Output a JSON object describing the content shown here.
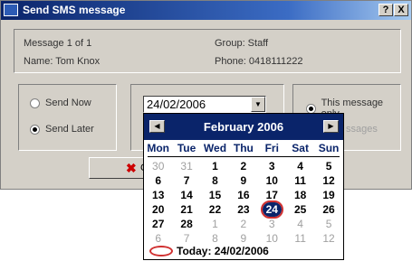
{
  "window": {
    "title": "Send SMS message",
    "help_label": "?",
    "close_label": "X"
  },
  "info": {
    "message_index": "Message 1 of 1",
    "name": "Name:  Tom Knox",
    "group": "Group:  Staff",
    "phone": "Phone:  0418111222"
  },
  "send_options": {
    "send_now": "Send Now",
    "send_later": "Send Later",
    "selected": "send_later"
  },
  "scope_options": {
    "this_only": "This message only",
    "all_messages_partial": "ssages"
  },
  "date_field": {
    "value": "24/02/2006"
  },
  "buttons": {
    "cancel": "C"
  },
  "calendar": {
    "month_title": "February 2006",
    "weekdays": [
      "Mon",
      "Tue",
      "Wed",
      "Thu",
      "Fri",
      "Sat",
      "Sun"
    ],
    "weeks": [
      [
        {
          "d": "30",
          "o": true
        },
        {
          "d": "31",
          "o": true
        },
        {
          "d": "1"
        },
        {
          "d": "2"
        },
        {
          "d": "3"
        },
        {
          "d": "4"
        },
        {
          "d": "5"
        }
      ],
      [
        {
          "d": "6"
        },
        {
          "d": "7"
        },
        {
          "d": "8"
        },
        {
          "d": "9"
        },
        {
          "d": "10"
        },
        {
          "d": "11"
        },
        {
          "d": "12"
        }
      ],
      [
        {
          "d": "13"
        },
        {
          "d": "14"
        },
        {
          "d": "15"
        },
        {
          "d": "16"
        },
        {
          "d": "17"
        },
        {
          "d": "18"
        },
        {
          "d": "19"
        }
      ],
      [
        {
          "d": "20"
        },
        {
          "d": "21"
        },
        {
          "d": "22"
        },
        {
          "d": "23"
        },
        {
          "d": "24",
          "sel": true
        },
        {
          "d": "25"
        },
        {
          "d": "26"
        }
      ],
      [
        {
          "d": "27"
        },
        {
          "d": "28"
        },
        {
          "d": "1",
          "o": true
        },
        {
          "d": "2",
          "o": true
        },
        {
          "d": "3",
          "o": true
        },
        {
          "d": "4",
          "o": true
        },
        {
          "d": "5",
          "o": true
        }
      ],
      [
        {
          "d": "6",
          "o": true
        },
        {
          "d": "7",
          "o": true
        },
        {
          "d": "8",
          "o": true
        },
        {
          "d": "9",
          "o": true
        },
        {
          "d": "10",
          "o": true
        },
        {
          "d": "11",
          "o": true
        },
        {
          "d": "12",
          "o": true
        }
      ]
    ],
    "today_label": "Today: 24/02/2006"
  }
}
